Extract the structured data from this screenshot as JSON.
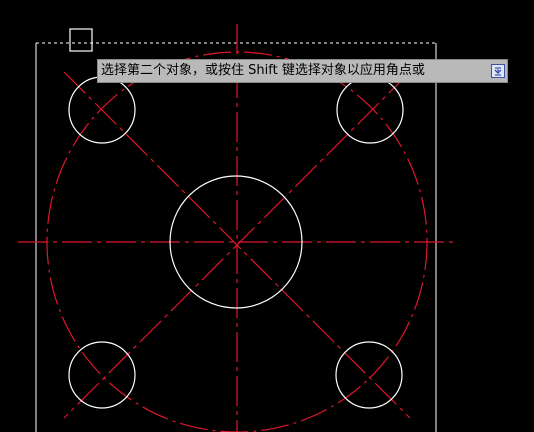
{
  "tooltip": {
    "text": "选择第二个对象，或按住 Shift 键选择对象以应用角点或"
  },
  "colors": {
    "background": "#000000",
    "geometry": "#ffffff",
    "centerline": "#e0162b",
    "tooltip_bg": "#b9b9b9",
    "icon_border": "#3b52a8"
  },
  "icons": {
    "tooltip_expand": "expand-down-icon",
    "pick_box": "pick-box-cursor-icon"
  }
}
